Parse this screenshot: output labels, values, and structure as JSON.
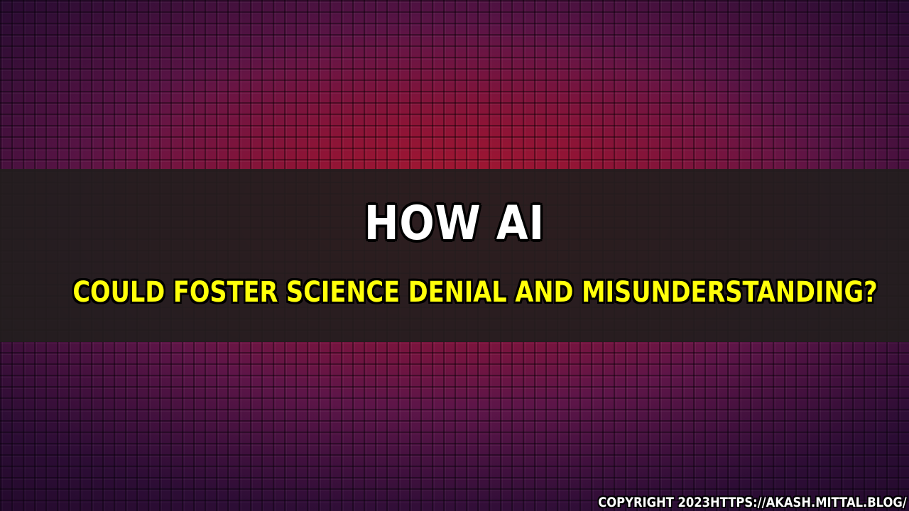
{
  "slide": {
    "title": "HOW AI",
    "subtitle": "COULD FOSTER SCIENCE DENIAL AND MISUNDERSTANDING?",
    "copyright": "COPYRIGHT 2023HTTPS://AKASH.MITTAL.BLOG/"
  },
  "colors": {
    "title_text": "#ffffff",
    "subtitle_text": "#ffff0a",
    "band": "#221e1e",
    "background_center": "#b0182e",
    "background_edge": "#3a1242"
  }
}
